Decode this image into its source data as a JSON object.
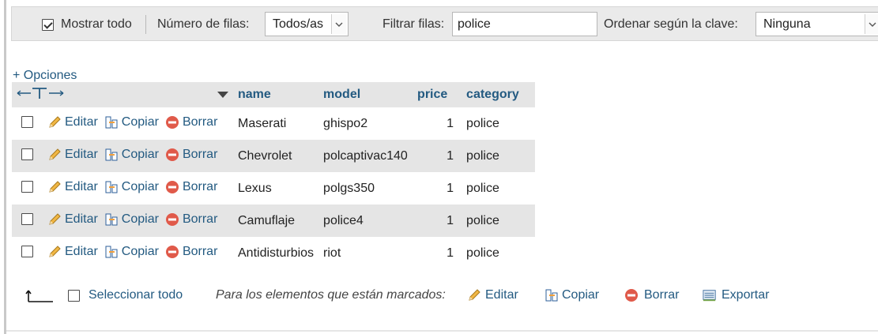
{
  "toolbar": {
    "show_all_label": "Mostrar todo",
    "show_all_checked": true,
    "rows_label": "Número de filas:",
    "rows_value": "Todos/as",
    "filter_label": "Filtrar filas:",
    "filter_value": "police",
    "sort_label": "Ordenar según la clave:",
    "sort_value": "Ninguna"
  },
  "options_link": "+ Opciones",
  "table": {
    "columns": [
      "name",
      "model",
      "price",
      "category"
    ],
    "actions": {
      "edit": "Editar",
      "copy": "Copiar",
      "delete": "Borrar"
    },
    "rows": [
      {
        "name": "Maserati",
        "model": "ghispo2",
        "price": "1",
        "category": "police"
      },
      {
        "name": "Chevrolet",
        "model": "polcaptivac140",
        "price": "1",
        "category": "police"
      },
      {
        "name": "Lexus",
        "model": "polgs350",
        "price": "1",
        "category": "police"
      },
      {
        "name": "Camuflaje",
        "model": "police4",
        "price": "1",
        "category": "police"
      },
      {
        "name": "Antidisturbios",
        "model": "riot",
        "price": "1",
        "category": "police"
      }
    ]
  },
  "footer": {
    "select_all": "Seleccionar todo",
    "with_selected": "Para los elementos que están marcados:",
    "edit": "Editar",
    "copy": "Copiar",
    "delete": "Borrar",
    "export": "Exportar"
  },
  "colors": {
    "link": "#235a81",
    "stripe": "#e5e5e5",
    "toolbar": "#eaeaea",
    "delete_icon": "#e05a4a"
  },
  "icons": [
    "pencil-icon",
    "copy-icon",
    "delete-icon",
    "export-icon",
    "arrow-up-left-icon",
    "column-arrows-icon",
    "sort-desc-icon",
    "chevron-down-icon"
  ]
}
